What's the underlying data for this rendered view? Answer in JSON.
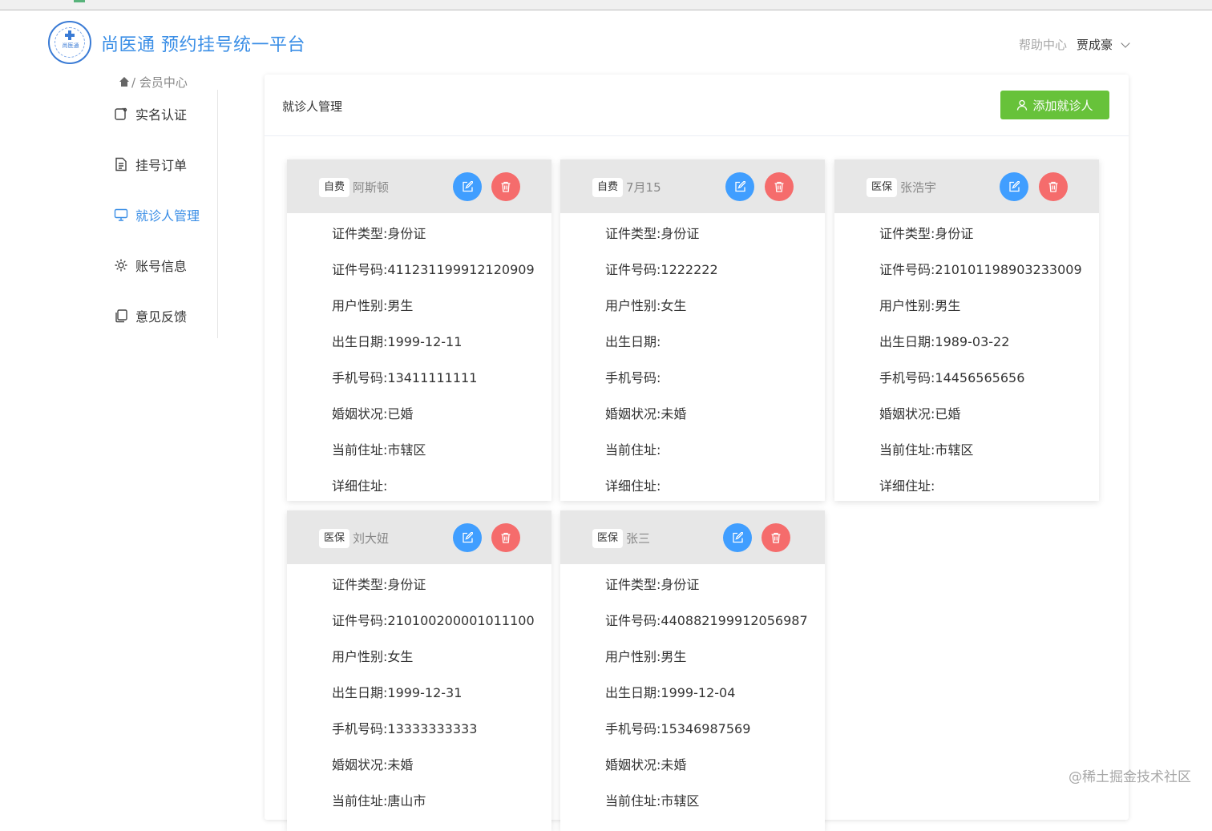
{
  "header": {
    "logo_text": "尚医通",
    "brand": "尚医通 预约挂号统一平台",
    "help": "帮助中心",
    "user": "贾成豪"
  },
  "breadcrumb": {
    "label": "/ 会员中心"
  },
  "sidebar": {
    "items": [
      {
        "label": "实名认证",
        "icon": "id-card-icon",
        "active": false
      },
      {
        "label": "挂号订单",
        "icon": "document-icon",
        "active": false
      },
      {
        "label": "就诊人管理",
        "icon": "monitor-icon",
        "active": true
      },
      {
        "label": "账号信息",
        "icon": "gear-icon",
        "active": false
      },
      {
        "label": "意见反馈",
        "icon": "copy-icon",
        "active": false
      }
    ]
  },
  "panel": {
    "title": "就诊人管理",
    "add_label": "添加就诊人"
  },
  "patients": [
    {
      "type": "自费",
      "name": "阿斯顿",
      "rows": [
        "证件类型:身份证",
        "证件号码:411231199912120909",
        "用户性别:男生",
        "出生日期:1999-12-11",
        "手机号码:13411111111",
        "婚姻状况:已婚",
        "当前住址:市辖区",
        "详细住址:"
      ]
    },
    {
      "type": "自费",
      "name": "7月15",
      "rows": [
        "证件类型:身份证",
        "证件号码:1222222",
        "用户性别:女生",
        "出生日期:",
        "手机号码:",
        "婚姻状况:未婚",
        "当前住址:",
        "详细住址:"
      ]
    },
    {
      "type": "医保",
      "name": "张浩宇",
      "rows": [
        "证件类型:身份证",
        "证件号码:210101198903233009",
        "用户性别:男生",
        "出生日期:1989-03-22",
        "手机号码:14456565656",
        "婚姻状况:已婚",
        "当前住址:市辖区",
        "详细住址:"
      ]
    },
    {
      "type": "医保",
      "name": "刘大妞",
      "rows": [
        "证件类型:身份证",
        "证件号码:210100200001011100",
        "用户性别:女生",
        "出生日期:1999-12-31",
        "手机号码:13333333333",
        "婚姻状况:未婚",
        "当前住址:唐山市"
      ]
    },
    {
      "type": "医保",
      "name": "张三",
      "rows": [
        "证件类型:身份证",
        "证件号码:440882199912056987",
        "用户性别:男生",
        "出生日期:1999-12-04",
        "手机号码:15346987569",
        "婚姻状况:未婚",
        "当前住址:市辖区"
      ]
    }
  ],
  "watermark": "@稀土掘金技术社区",
  "colors": {
    "brand": "#3a8ee6",
    "add_button": "#67c23a",
    "edit": "#409eff",
    "delete": "#f56c6c"
  }
}
